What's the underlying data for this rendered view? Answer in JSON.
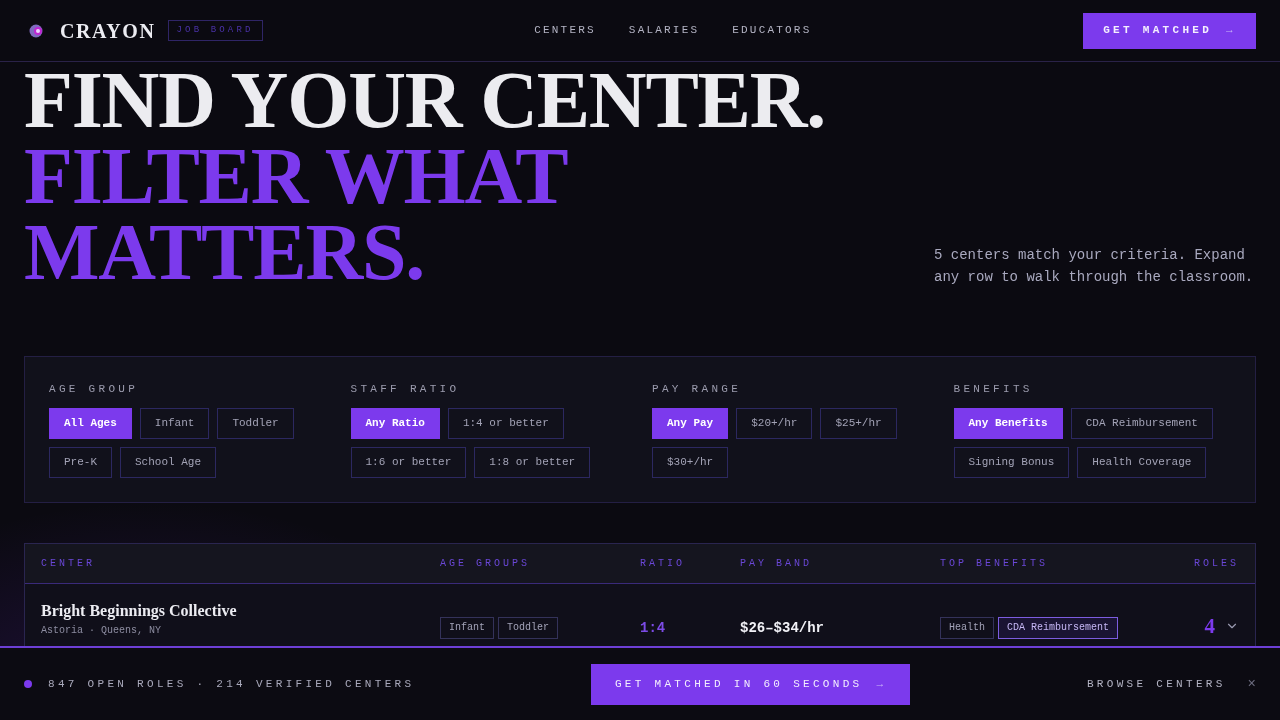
{
  "header": {
    "logo": "CRAYON",
    "badge": "JOB BOARD",
    "nav": [
      {
        "label": "CENTERS"
      },
      {
        "label": "SALARIES"
      },
      {
        "label": "EDUCATORS"
      }
    ],
    "cta": {
      "label": "GET MATCHED",
      "arrow": "→"
    }
  },
  "hero": {
    "lines": [
      {
        "text": "FIND YOUR CENTER.",
        "accent": false
      },
      {
        "text": "FILTER WHAT",
        "accent": true
      },
      {
        "text": "MATTERS.",
        "accent": true
      }
    ],
    "summary": "5 centers match your criteria. Expand any row to walk through the classroom."
  },
  "filters": [
    {
      "label": "AGE GROUP",
      "options": [
        {
          "label": "All Ages",
          "selected": true
        },
        {
          "label": "Infant",
          "selected": false
        },
        {
          "label": "Toddler",
          "selected": false
        },
        {
          "label": "Pre-K",
          "selected": false
        },
        {
          "label": "School Age",
          "selected": false
        }
      ]
    },
    {
      "label": "STAFF RATIO",
      "options": [
        {
          "label": "Any Ratio",
          "selected": true
        },
        {
          "label": "1:4 or better",
          "selected": false
        },
        {
          "label": "1:6 or better",
          "selected": false
        },
        {
          "label": "1:8 or better",
          "selected": false
        }
      ]
    },
    {
      "label": "PAY RANGE",
      "options": [
        {
          "label": "Any Pay",
          "selected": true
        },
        {
          "label": "$20+/hr",
          "selected": false
        },
        {
          "label": "$25+/hr",
          "selected": false
        },
        {
          "label": "$30+/hr",
          "selected": false
        }
      ]
    },
    {
      "label": "BENEFITS",
      "options": [
        {
          "label": "Any Benefits",
          "selected": true
        },
        {
          "label": "CDA Reimbursement",
          "selected": false
        },
        {
          "label": "Signing Bonus",
          "selected": false
        },
        {
          "label": "Health Coverage",
          "selected": false
        }
      ]
    }
  ],
  "table": {
    "columns": [
      "CENTER",
      "AGE GROUPS",
      "RATIO",
      "PAY BAND",
      "TOP BENEFITS",
      "ROLES"
    ],
    "rows": [
      {
        "name": "Bright Beginnings Collective",
        "location": "Astoria · Queens, NY",
        "age_groups": [
          "Infant",
          "Toddler"
        ],
        "ratio": "1:4",
        "pay_band": "$26–$34/hr",
        "benefits": [
          {
            "label": "Health",
            "highlighted": false
          },
          {
            "label": "CDA Reimbursement",
            "highlighted": true
          }
        ],
        "roles": "4",
        "expanded": false
      }
    ]
  },
  "bottom_bar": {
    "stats": "847 OPEN ROLES · 214 VERIFIED CENTERS",
    "cta": {
      "label": "GET MATCHED IN 60 SECONDS",
      "arrow": "→"
    },
    "link": "BROWSE CENTERS",
    "close": "×"
  }
}
